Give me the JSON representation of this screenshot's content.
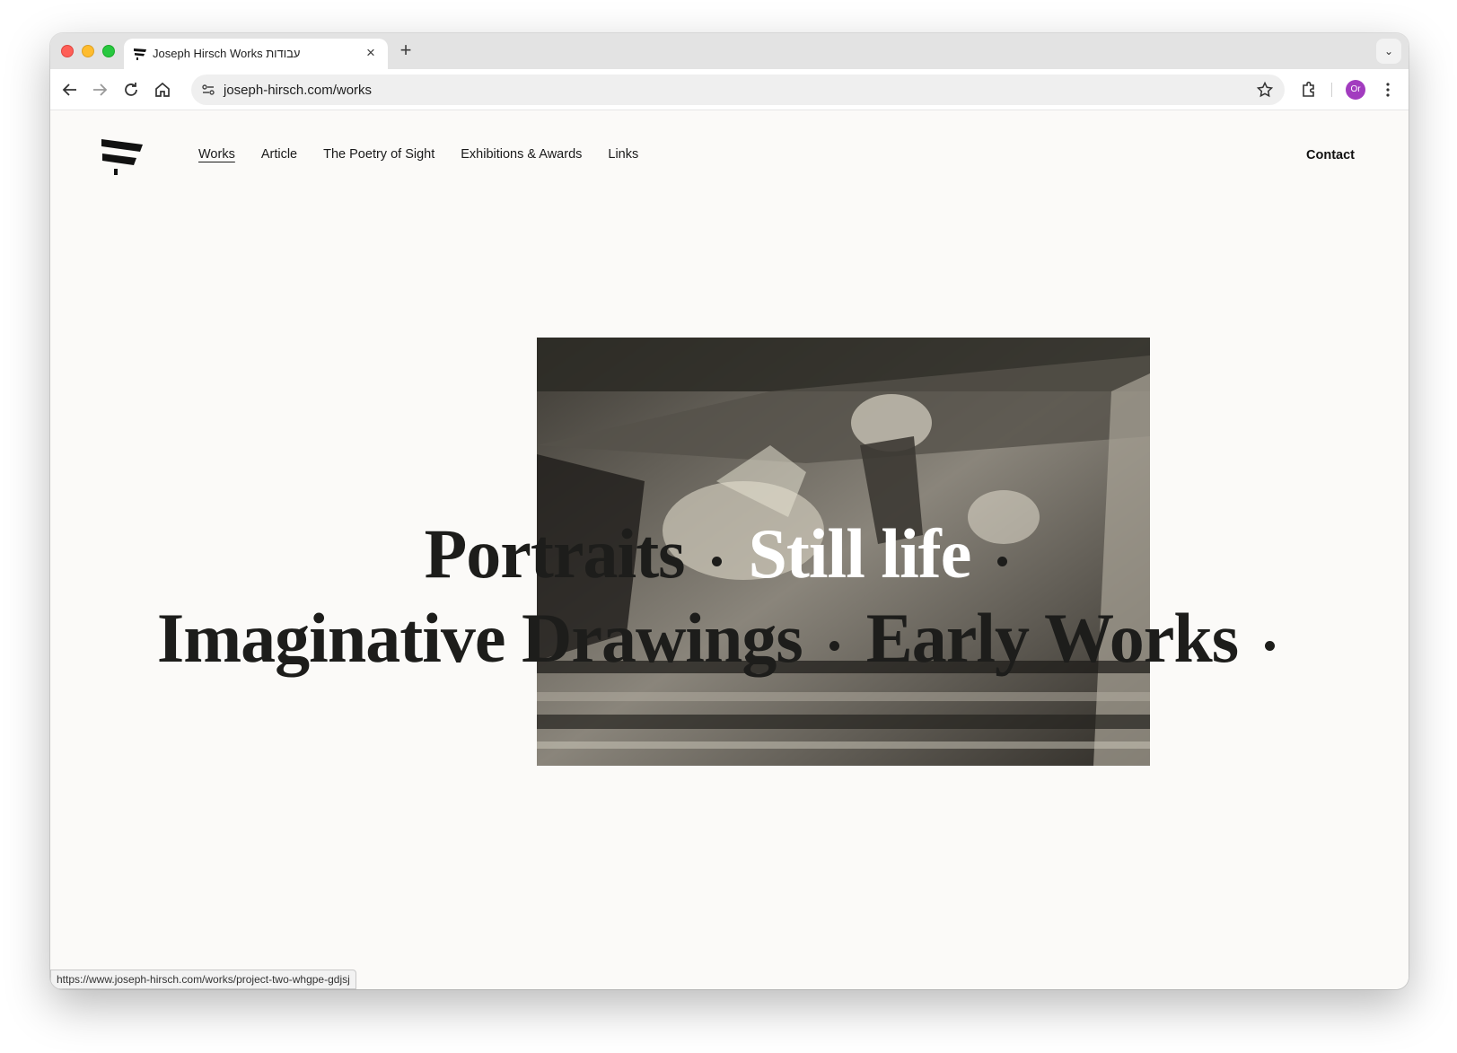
{
  "browser": {
    "tab_title": "Joseph Hirsch Works עבודות",
    "tab_close": "×",
    "new_tab": "+",
    "tab_menu": "⌄",
    "url": "joseph-hirsch.com/works",
    "profile_initials": "Or",
    "status_url": "https://www.joseph-hirsch.com/works/project-two-whgpe-gdjsj"
  },
  "nav": {
    "items": [
      {
        "label": "Works",
        "active": true
      },
      {
        "label": "Article",
        "active": false
      },
      {
        "label": "The Poetry of Sight",
        "active": false
      },
      {
        "label": "Exhibitions & Awards",
        "active": false
      },
      {
        "label": "Links",
        "active": false
      }
    ],
    "contact": "Contact"
  },
  "categories": [
    {
      "label": "Portraits",
      "highlighted": false
    },
    {
      "label": "Still life",
      "highlighted": true
    },
    {
      "label": "Imaginative Drawings",
      "highlighted": false
    },
    {
      "label": "Early Works",
      "highlighted": false
    }
  ],
  "colors": {
    "page_bg": "#fbfaf8",
    "text": "#1d1d1b",
    "highlight_text": "#ffffff",
    "profile": "#a23cbf"
  }
}
